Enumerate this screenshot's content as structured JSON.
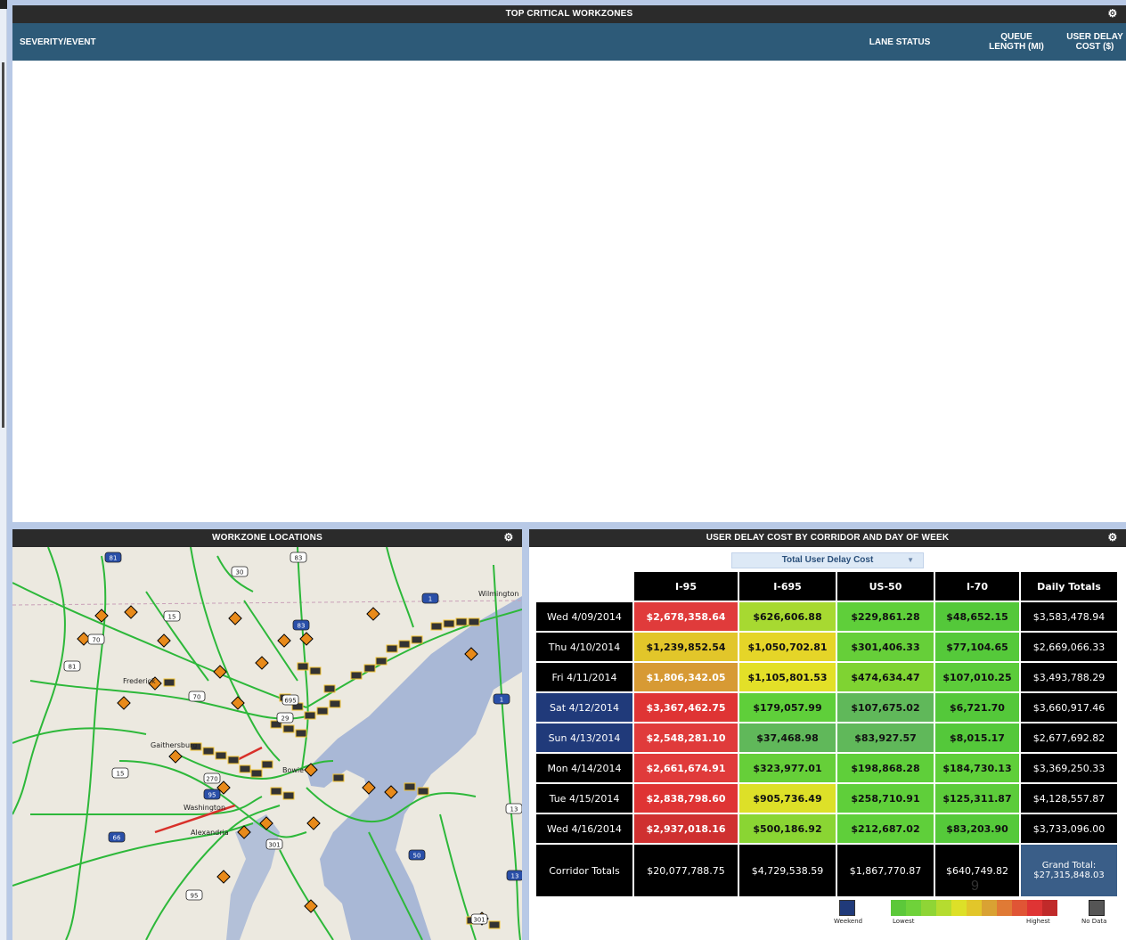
{
  "top_panel": {
    "title": "TOP CRITICAL WORKZONES",
    "columns": [
      "SEVERITY/EVENT",
      "LANE STATUS",
      "QUEUE LENGTH (MI)",
      "USER DELAY COST ($)"
    ]
  },
  "map_panel": {
    "title": "WORKZONE LOCATIONS",
    "place_labels": [
      "Wilmington",
      "Frederick",
      "Gaithersburg",
      "Washington",
      "Alexandria",
      "Bowie"
    ],
    "route_shields": [
      "81",
      "30",
      "83",
      "1",
      "15",
      "70",
      "83",
      "81",
      "70",
      "1",
      "695",
      "270",
      "95",
      "29",
      "15",
      "66",
      "95",
      "301",
      "50",
      "13",
      "301",
      "13"
    ]
  },
  "table_panel": {
    "title": "USER DELAY COST BY CORRIDOR AND DAY OF WEEK",
    "dropdown": "Total User Delay Cost",
    "headers": [
      "I-95",
      "I-695",
      "US-50",
      "I-70",
      "Daily Totals"
    ],
    "rows": [
      {
        "day": "Wed 4/09/2014",
        "weekend": false,
        "values": [
          "$2,678,358.64",
          "$626,606.88",
          "$229,861.28",
          "$48,652.15"
        ],
        "colors": [
          "#e03b3b",
          "#a7d931",
          "#5fcf3a",
          "#54c83a"
        ],
        "daily": "$3,583,478.94"
      },
      {
        "day": "Thu 4/10/2014",
        "weekend": false,
        "values": [
          "$1,239,852.54",
          "$1,050,702.81",
          "$301,406.33",
          "$77,104.65"
        ],
        "colors": [
          "#e2c62a",
          "#e5d528",
          "#66cf39",
          "#55c93a"
        ],
        "daily": "$2,669,066.33"
      },
      {
        "day": "Fri 4/11/2014",
        "weekend": false,
        "values": [
          "$1,806,342.05",
          "$1,105,801.53",
          "$474,634.47",
          "$107,010.25"
        ],
        "colors": [
          "#d79a34",
          "#e3e028",
          "#7fd332",
          "#5ccc3a"
        ],
        "daily": "$3,493,788.29"
      },
      {
        "day": "Sat 4/12/2014",
        "weekend": true,
        "values": [
          "$3,367,462.75",
          "$179,057.99",
          "$107,675.02",
          "$6,721.70"
        ],
        "colors": [
          "#df3434",
          "#5fcf3a",
          "#60b85a",
          "#54c83a"
        ],
        "daily": "$3,660,917.46"
      },
      {
        "day": "Sun 4/13/2014",
        "weekend": true,
        "values": [
          "$2,548,281.10",
          "$37,468.98",
          "$83,927.57",
          "$8,015.17"
        ],
        "colors": [
          "#e03b3b",
          "#60b85a",
          "#60b85a",
          "#54c83a"
        ],
        "daily": "$2,677,692.82"
      },
      {
        "day": "Mon 4/14/2014",
        "weekend": false,
        "values": [
          "$2,661,674.91",
          "$323,977.01",
          "$198,868.28",
          "$184,730.13"
        ],
        "colors": [
          "#e03b3b",
          "#66cf39",
          "#5fcf3a",
          "#5fcf3a"
        ],
        "daily": "$3,369,250.33"
      },
      {
        "day": "Tue 4/15/2014",
        "weekend": false,
        "values": [
          "$2,838,798.60",
          "$905,736.49",
          "$258,710.91",
          "$125,311.87"
        ],
        "colors": [
          "#df3434",
          "#dde028",
          "#5fcf3a",
          "#5ccc3a"
        ],
        "daily": "$4,128,557.87"
      },
      {
        "day": "Wed 4/16/2014",
        "weekend": false,
        "values": [
          "$2,937,018.16",
          "$500,186.92",
          "$212,687.02",
          "$83,203.90"
        ],
        "colors": [
          "#cf3030",
          "#8ad533",
          "#5fcf3a",
          "#55c93a"
        ],
        "daily": "$3,733,096.00"
      }
    ],
    "totals_label": "Corridor Totals",
    "totals": [
      "$20,077,788.75",
      "$4,729,538.59",
      "$1,867,770.87",
      "$640,749.82"
    ],
    "grand_total_label": "Grand Total:",
    "grand_total": "$27,315,848.03",
    "page_number": "9",
    "legend": {
      "weekend": "Weekend",
      "lowest": "Lowest",
      "highest": "Highest",
      "no_data": "No Data",
      "weekend_color": "#203a7a",
      "no_data_color": "#555555",
      "scale_colors": [
        "#5cc83a",
        "#6fd23a",
        "#8fd536",
        "#b5dc30",
        "#dde028",
        "#e2c62a",
        "#d9a233",
        "#e07a35",
        "#e05535",
        "#df3434",
        "#c02a2a"
      ]
    }
  }
}
